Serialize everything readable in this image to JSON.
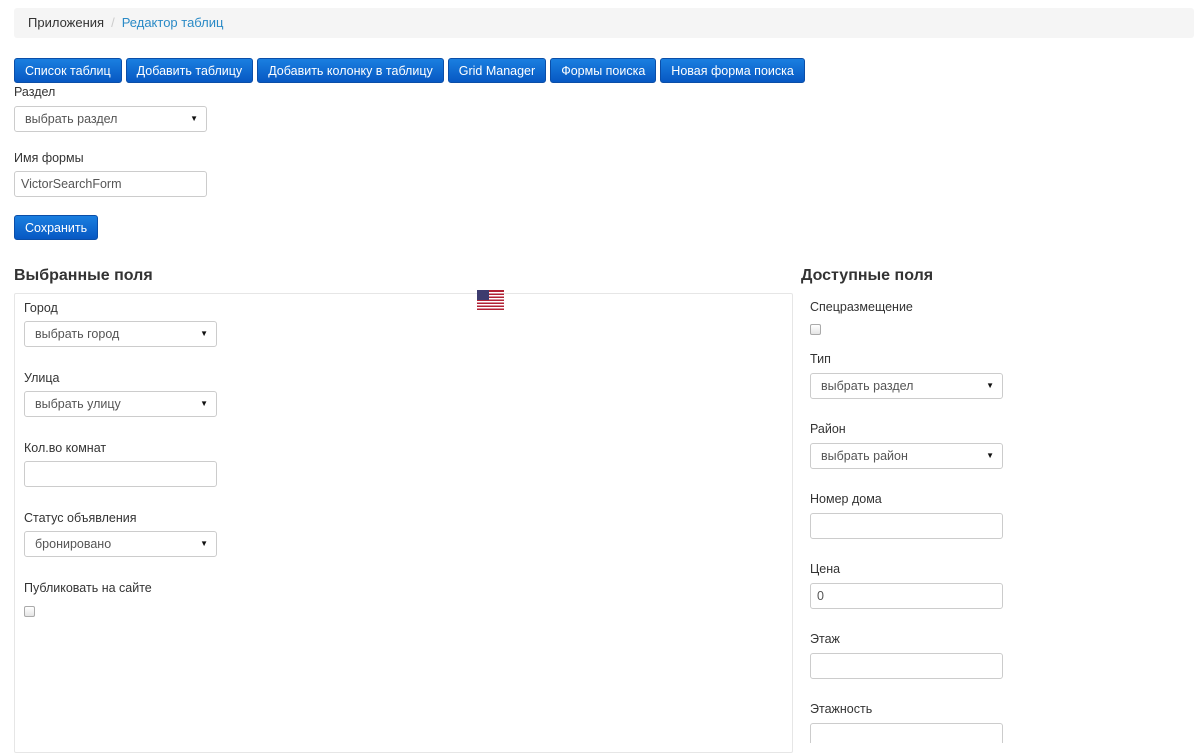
{
  "breadcrumb": {
    "root": "Приложения",
    "separator": "/",
    "current": "Редактор таблиц"
  },
  "toolbar": {
    "buttons": [
      "Список таблиц",
      "Добавить таблицу",
      "Добавить колонку в таблицу",
      "Grid Manager",
      "Формы поиска",
      "Новая форма поиска"
    ]
  },
  "form": {
    "section_label": "Раздел",
    "section_value": "выбрать раздел",
    "name_label": "Имя формы",
    "name_value": "VictorSearchForm",
    "save_label": "Сохранить"
  },
  "selected": {
    "title": "Выбранные поля",
    "city_label": "Город",
    "city_value": "выбрать город",
    "street_label": "Улица",
    "street_value": "выбрать улицу",
    "rooms_label": "Кол.во комнат",
    "rooms_value": "",
    "status_label": "Статус объявления",
    "status_value": "бронировано",
    "publish_label": "Публиковать на сайте",
    "publish_checked": false
  },
  "available": {
    "title": "Доступные поля",
    "special_label": "Спецразмещение",
    "special_checked": false,
    "type_label": "Тип",
    "type_value": "выбрать раздел",
    "district_label": "Район",
    "district_value": "выбрать район",
    "house_label": "Номер дома",
    "house_value": "",
    "price_label": "Цена",
    "price_value": "0",
    "floor_label": "Этаж",
    "floor_value": "",
    "floors_label": "Этажность",
    "floors_value": ""
  },
  "icons": {
    "flag": "us-flag-icon",
    "caret": "caret-down-icon"
  },
  "colors": {
    "button_primary": "#0b66d0",
    "link": "#2a8ac6",
    "breadcrumb_bg": "#f5f5f5"
  }
}
